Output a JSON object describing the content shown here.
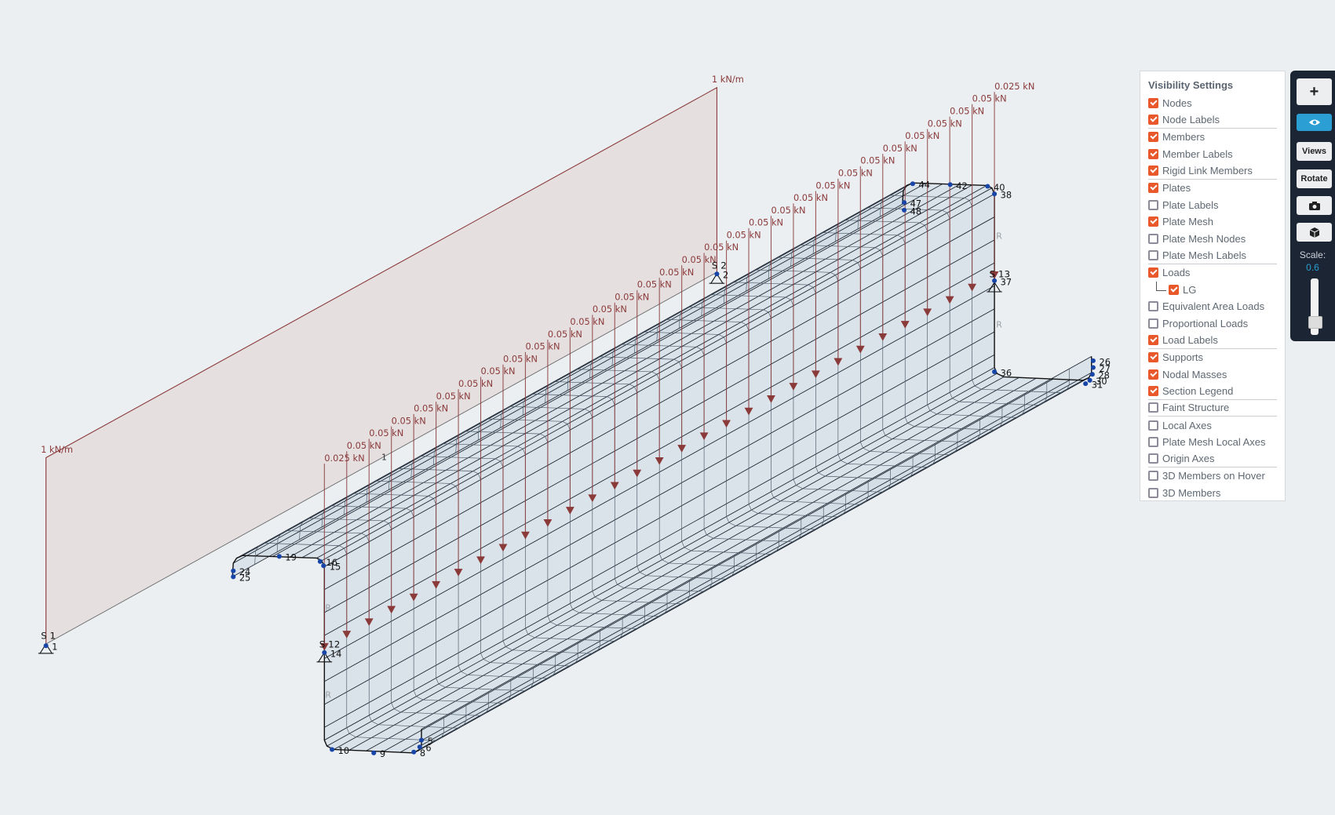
{
  "visibility_panel": {
    "title": "Visibility Settings",
    "items": [
      {
        "label": "Nodes",
        "checked": true
      },
      {
        "label": "Node Labels",
        "checked": true,
        "divider": true
      },
      {
        "label": "Members",
        "checked": true
      },
      {
        "label": "Member Labels",
        "checked": true
      },
      {
        "label": "Rigid Link Members",
        "checked": true,
        "divider": true
      },
      {
        "label": "Plates",
        "checked": true
      },
      {
        "label": "Plate Labels",
        "checked": false
      },
      {
        "label": "Plate Mesh",
        "checked": true
      },
      {
        "label": "Plate Mesh Nodes",
        "checked": false
      },
      {
        "label": "Plate Mesh Labels",
        "checked": false,
        "divider": true
      },
      {
        "label": "Loads",
        "checked": true
      },
      {
        "label": "LG",
        "checked": true,
        "sub": true
      },
      {
        "label": "Equivalent Area Loads",
        "checked": false
      },
      {
        "label": "Proportional Loads",
        "checked": false
      },
      {
        "label": "Load Labels",
        "checked": true,
        "divider": true
      },
      {
        "label": "Supports",
        "checked": true
      },
      {
        "label": "Nodal Masses",
        "checked": true
      },
      {
        "label": "Section Legend",
        "checked": true,
        "divider": true
      },
      {
        "label": "Faint Structure",
        "checked": false,
        "divider": true
      },
      {
        "label": "Local Axes",
        "checked": false
      },
      {
        "label": "Plate Mesh Local Axes",
        "checked": false
      },
      {
        "label": "Origin Axes",
        "checked": false,
        "divider": true
      },
      {
        "label": "3D Members on Hover",
        "checked": false
      },
      {
        "label": "3D Members",
        "checked": false
      }
    ]
  },
  "toolbar": {
    "add_icon": "plus-icon",
    "visibility_icon": "eye-icon",
    "views_label": "Views",
    "rotate_label": "Rotate",
    "screenshot_icon": "camera-icon",
    "model_icon": "cube-icon",
    "scale_label": "Scale:",
    "scale_value": "0.6",
    "active_color": "#2b9fd3"
  },
  "model": {
    "line_loads": [
      "1 kN/m",
      "1 kN/m"
    ],
    "point_loads": [
      "0.025 kN",
      "0.05 kN",
      "0.05 kN",
      "0.05 kN",
      "0.05 kN",
      "0.05 kN",
      "0.05 kN",
      "0.05 kN",
      "0.05 kN",
      "0.05 kN",
      "0.05 kN",
      "0.05 kN",
      "0.05 kN",
      "0.05 kN",
      "0.05 kN",
      "0.05 kN",
      "0.05 kN",
      "0.05 kN",
      "0.05 kN",
      "0.05 kN",
      "0.05 kN",
      "0.05 kN",
      "0.05 kN",
      "0.05 kN",
      "0.05 kN",
      "0.05 kN",
      "0.05 kN",
      "0.05 kN",
      "0.05 kN",
      "0.05 kN",
      "0.025 kN"
    ],
    "supports": [
      "S 1",
      "S 2",
      "S 12",
      "S 13"
    ],
    "member_label": "1",
    "rigid_label": "R",
    "node_labels": [
      "1",
      "2",
      "14",
      "37",
      "19",
      "15",
      "16",
      "24",
      "25",
      "9",
      "10",
      "8",
      "6",
      "5",
      "26",
      "27",
      "28",
      "30",
      "31",
      "36",
      "38",
      "40",
      "42",
      "44",
      "47",
      "48"
    ],
    "load_color": "#8b3a3a",
    "node_color": "#1846a8"
  }
}
